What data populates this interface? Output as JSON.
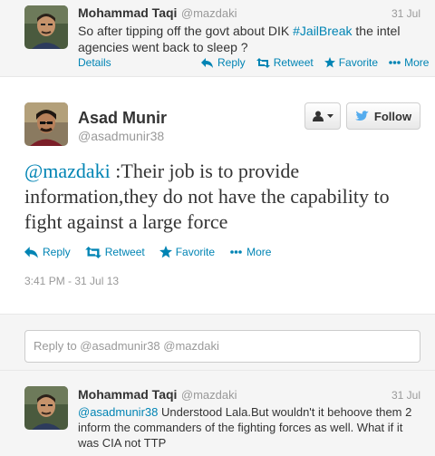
{
  "tweet1": {
    "name": "Mohammad Taqi",
    "handle": "@mazdaki",
    "date": "31 Jul",
    "text_before": "So after tipping off the govt about DIK ",
    "hashtag": "#JailBreak",
    "text_after": " the intel agencies went back to sleep ?",
    "details": "Details",
    "reply": "Reply",
    "retweet": "Retweet",
    "favorite": "Favorite",
    "more": "More"
  },
  "tweet2": {
    "name": "Asad Munir",
    "handle": "@asadmunir38",
    "follow": "Follow",
    "mention": "@mazdaki",
    "text": " :Their job is to provide information,they do not have the  capability to fight against a large force",
    "reply": "Reply",
    "retweet": "Retweet",
    "favorite": "Favorite",
    "more": "More",
    "timestamp": "3:41 PM - 31 Jul 13"
  },
  "reply_box": {
    "placeholder": "Reply to @asadmunir38 @mazdaki"
  },
  "tweet3": {
    "name": "Mohammad Taqi",
    "handle": "@mazdaki",
    "date": "31 Jul",
    "mention": "@asadmunir38",
    "text": " Understood Lala.But wouldn't it behoove them 2 inform the commanders of the fighting forces as well. What if it was CIA not TTP"
  },
  "colors": {
    "link": "#0084b4",
    "background_compact": "#f5f5f5",
    "twitter_blue": "#55acee"
  }
}
